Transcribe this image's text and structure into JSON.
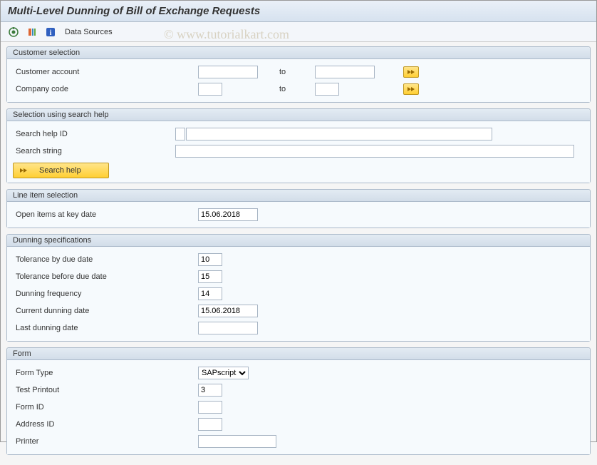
{
  "title": "Multi-Level Dunning of Bill of Exchange Requests",
  "toolbar": {
    "data_sources": "Data Sources"
  },
  "watermark": "©  www.tutorialkart.com",
  "groups": {
    "customer_selection": {
      "title": "Customer selection",
      "customer_account_label": "Customer account",
      "company_code_label": "Company code",
      "to_label": "to"
    },
    "search_help": {
      "title": "Selection using search help",
      "search_help_id_label": "Search help ID",
      "search_string_label": "Search string",
      "button_label": "Search help"
    },
    "line_item": {
      "title": "Line item selection",
      "open_items_label": "Open items at key date",
      "open_items_value": "15.06.2018"
    },
    "dunning": {
      "title": "Dunning specifications",
      "tol_due_label": "Tolerance by due date",
      "tol_due_value": "10",
      "tol_before_label": "Tolerance before due date",
      "tol_before_value": "15",
      "freq_label": "Dunning frequency",
      "freq_value": "14",
      "current_label": "Current dunning date",
      "current_value": "15.06.2018",
      "last_label": "Last dunning date",
      "last_value": ""
    },
    "form": {
      "title": "Form",
      "form_type_label": "Form Type",
      "form_type_value": "SAPscript",
      "test_label": "Test Printout",
      "test_value": "3",
      "formid_label": "Form ID",
      "addressid_label": "Address ID",
      "printer_label": "Printer"
    }
  }
}
